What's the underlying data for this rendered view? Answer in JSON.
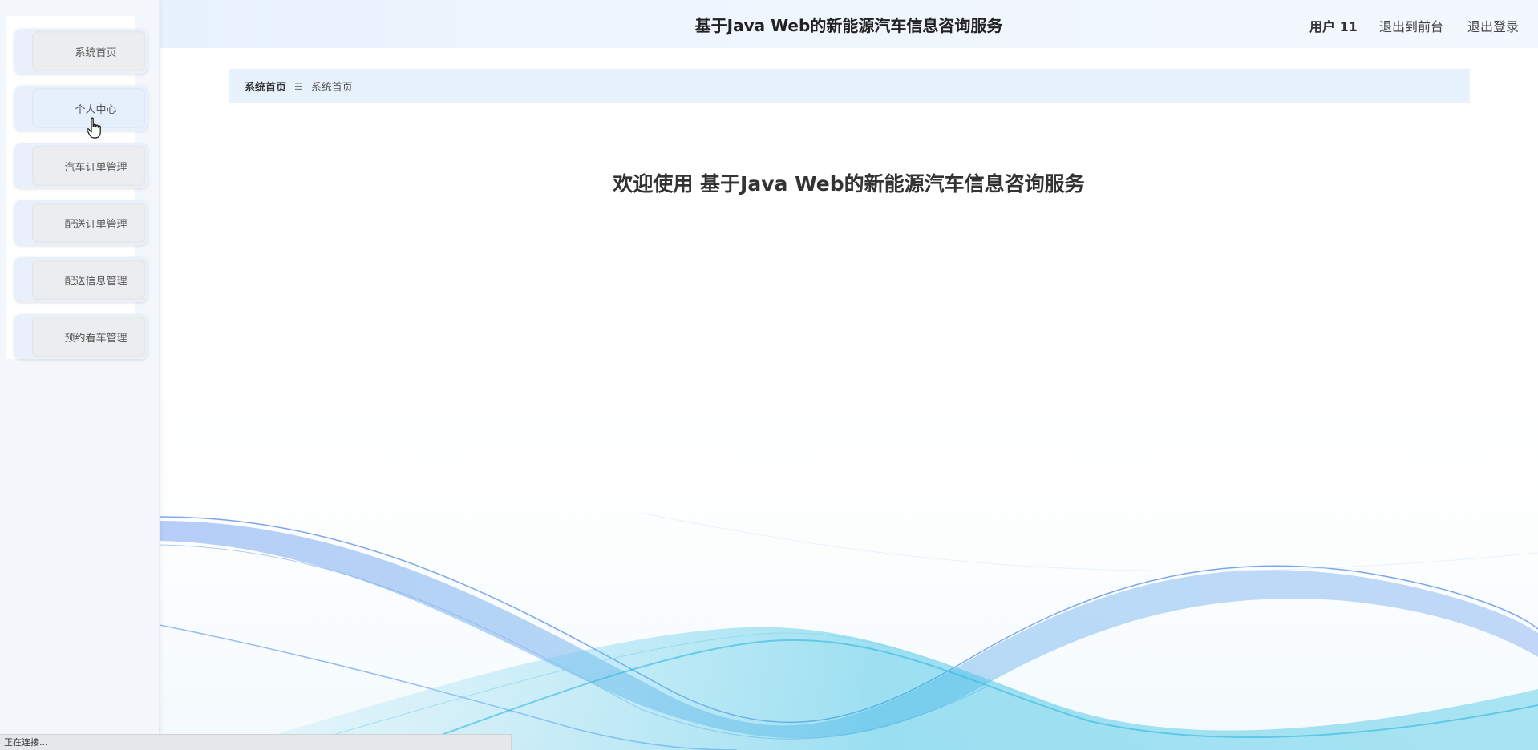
{
  "header": {
    "title": "基于Java Web的新能源汽车信息咨询服务",
    "user_label": "用户 11",
    "back_to_front": "退出到前台",
    "logout": "退出登录"
  },
  "sidebar": {
    "items": [
      {
        "label": "系统首页"
      },
      {
        "label": "个人中心"
      },
      {
        "label": "汽车订单管理"
      },
      {
        "label": "配送订单管理"
      },
      {
        "label": "配送信息管理"
      },
      {
        "label": "预约看车管理"
      }
    ],
    "active_index": 1
  },
  "breadcrumb": {
    "first": "系统首页",
    "separator_icon": "menu-icon",
    "current": "系统首页"
  },
  "main": {
    "welcome": "欢迎使用 基于Java Web的新能源汽车信息咨询服务"
  },
  "statusbar": {
    "text": "正在连接..."
  },
  "colors": {
    "header_bg": "#e8f2fd",
    "sidebar_bg": "#f3f7fc",
    "wave_blue": "#5b8fe8",
    "wave_cyan": "#4cc3e0"
  }
}
